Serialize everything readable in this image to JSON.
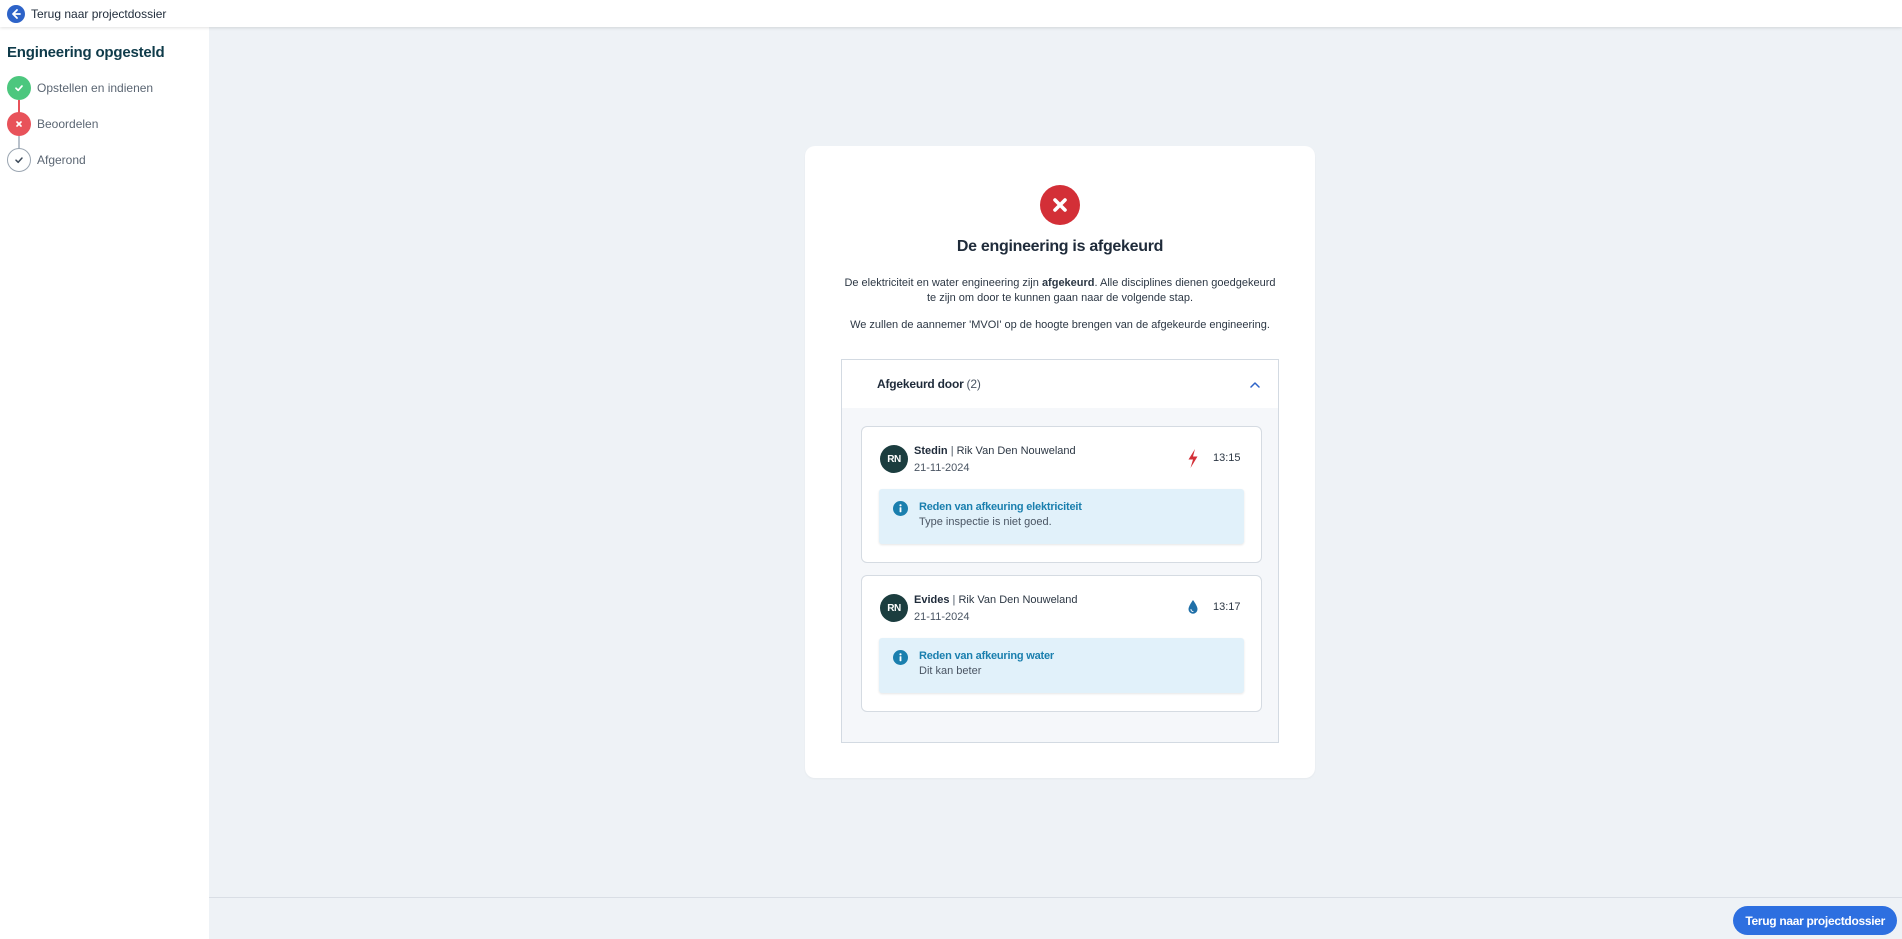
{
  "topbar": {
    "back_label": "Terug naar projectdossier",
    "icon": "arrow-left-icon"
  },
  "sidebar": {
    "title": "Engineering opgesteld",
    "steps": [
      {
        "label": "Opstellen en indienen",
        "status": "done",
        "icon": "check-icon",
        "color": "#4cc77e"
      },
      {
        "label": "Beoordelen",
        "status": "rejected",
        "icon": "close-icon",
        "color": "#e8525a"
      },
      {
        "label": "Afgerond",
        "status": "pending",
        "icon": "check-icon",
        "color": "#ffffff"
      }
    ]
  },
  "card": {
    "status_icon": "x-circle-icon",
    "status_color": "#d32f37",
    "title": "De engineering is afgekeurd",
    "paragraph1_prefix": "De elektriciteit en water engineering zijn ",
    "paragraph1_bold": "afgekeurd",
    "paragraph1_suffix": ". Alle disciplines dienen goedgekeurd te zijn om door te kunnen gaan naar de volgende stap.",
    "paragraph2": "We zullen de aannemer 'MVOI' op de hoogte brengen van de afgekeurde engineering."
  },
  "accordion": {
    "title": "Afgekeurd door",
    "count": "(2)",
    "expanded": true,
    "toggle_icon": "chevron-up-icon",
    "entries": [
      {
        "initials": "RN",
        "organisation": "Stedin",
        "separator": "|",
        "person": "Rik Van Den Nouweland",
        "date": "21-11-2024",
        "time": "13:15",
        "discipline_icon": "lightning-icon",
        "discipline_color": "#d32f37",
        "reason_title": "Reden van afkeuring elektriciteit",
        "reason_text": "Type inspectie is niet goed."
      },
      {
        "initials": "RN",
        "organisation": "Evides",
        "separator": "|",
        "person": "Rik Van Den Nouweland",
        "date": "21-11-2024",
        "time": "13:17",
        "discipline_icon": "water-drop-icon",
        "discipline_color": "#1f6fa8",
        "reason_title": "Reden van afkeuring water",
        "reason_text": "Dit kan beter"
      }
    ]
  },
  "footer": {
    "button_label": "Terug naar projectdossier",
    "button_color": "#2d6fe0"
  }
}
